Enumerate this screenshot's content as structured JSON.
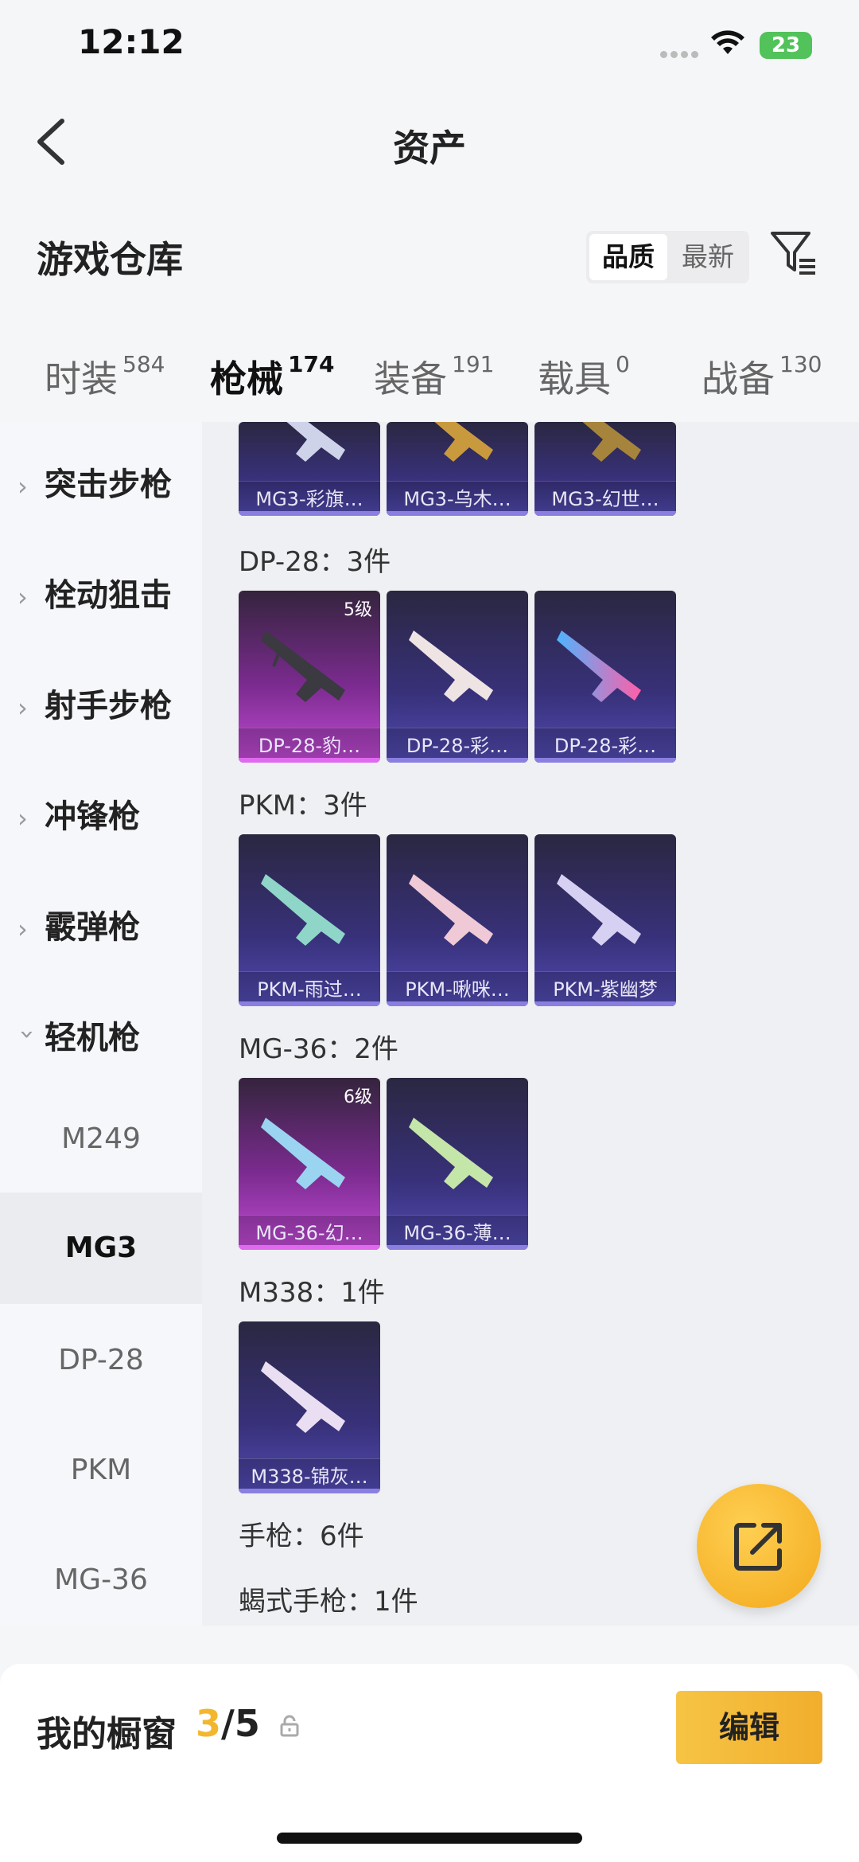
{
  "status_bar": {
    "time": "12:12",
    "battery": "23"
  },
  "header": {
    "title": "资产"
  },
  "warehouse": {
    "title": "游戏仓库",
    "sort_options": [
      "品质",
      "最新"
    ],
    "selected_sort": "品质"
  },
  "tabs": [
    {
      "label": "时装",
      "count": "584"
    },
    {
      "label": "枪械",
      "count": "174",
      "active": true
    },
    {
      "label": "装备",
      "count": "191"
    },
    {
      "label": "载具",
      "count": "0"
    },
    {
      "label": "战备",
      "count": "130"
    }
  ],
  "sidebar": {
    "categories": [
      "突击步枪",
      "栓动狙击",
      "射手步枪",
      "冲锋枪",
      "霰弹枪",
      "轻机枪"
    ],
    "subitems": [
      "M249",
      "MG3",
      "DP-28",
      "PKM",
      "MG-36"
    ],
    "active_sub": "MG3"
  },
  "groups": [
    {
      "name": "MG3",
      "items": [
        {
          "label": "MG3-彩旗…",
          "quality": "purple"
        },
        {
          "label": "MG3-乌木…",
          "quality": "purple"
        },
        {
          "label": "MG3-幻世…",
          "quality": "purple"
        }
      ]
    },
    {
      "name": "DP-28：3件",
      "items": [
        {
          "label": "DP-28-豹…",
          "quality": "pink",
          "level": "5级"
        },
        {
          "label": "DP-28-彩…",
          "quality": "purple"
        },
        {
          "label": "DP-28-彩…",
          "quality": "purple"
        }
      ]
    },
    {
      "name": "PKM：3件",
      "items": [
        {
          "label": "PKM-雨过…",
          "quality": "purple"
        },
        {
          "label": "PKM-啾咪…",
          "quality": "purple"
        },
        {
          "label": "PKM-紫幽梦",
          "quality": "purple"
        }
      ]
    },
    {
      "name": "MG-36：2件",
      "items": [
        {
          "label": "MG-36-幻…",
          "quality": "pink",
          "level": "6级"
        },
        {
          "label": "MG-36-薄…",
          "quality": "purple"
        }
      ]
    },
    {
      "name": "M338：1件",
      "items": [
        {
          "label": "M338-锦灰…",
          "quality": "purple"
        }
      ]
    }
  ],
  "more_groups": [
    "手枪：6件",
    "蝎式手枪：1件"
  ],
  "showcase": {
    "title": "我的橱窗",
    "used": "3",
    "total": "/5",
    "edit_label": "编辑"
  },
  "colors": {
    "accent": "#f2b72f",
    "card_purple": "#524bb3",
    "card_pink": "#c24bd6"
  }
}
